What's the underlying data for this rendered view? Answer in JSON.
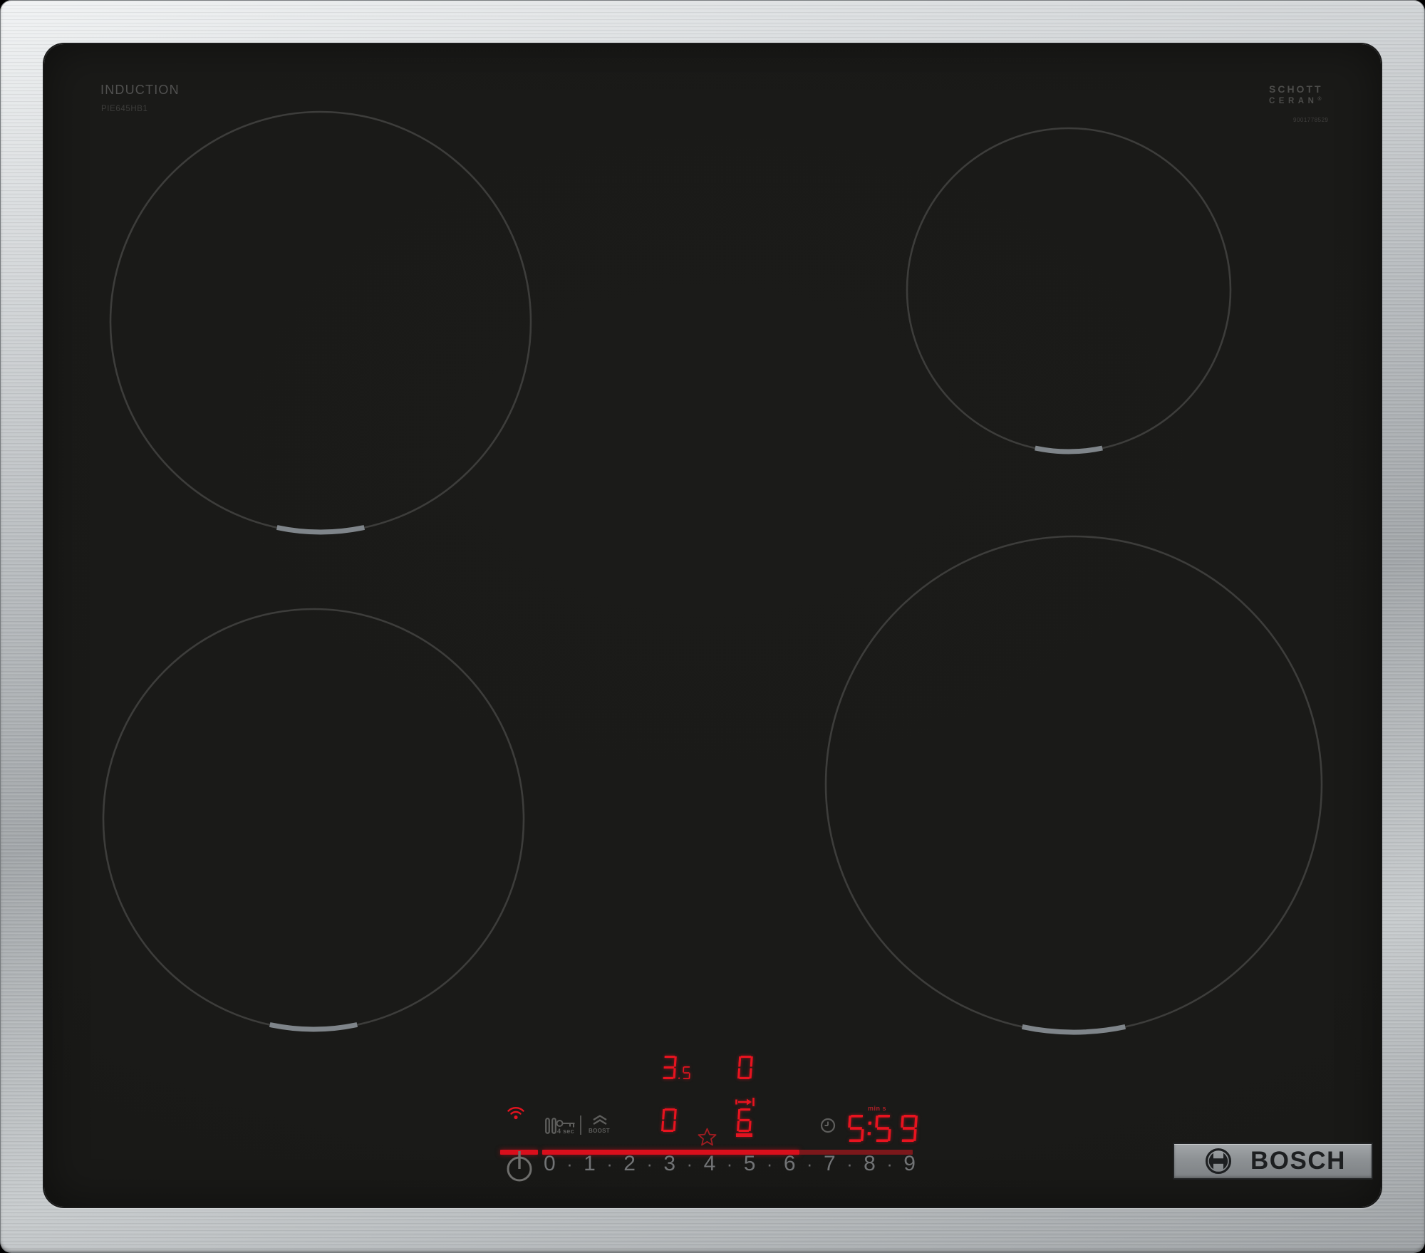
{
  "hob": {
    "type_label": "INDUCTION",
    "model": "PIE645HB1",
    "glass_brand_line1": "SCHOTT",
    "glass_brand_line2": "CERAN",
    "registered_mark": "®",
    "serial": "9001778529",
    "brand": "BOSCH"
  },
  "control_panel": {
    "zone_displays": {
      "back_left": "3.5",
      "back_right": "0",
      "front_left": "0",
      "front_right": "6"
    },
    "timer": {
      "display": "5:5 9",
      "value": "5:59",
      "unit_label": "min s"
    },
    "key_lock_label": "4 sec",
    "boost_label": "BOOST",
    "scale_numbers": [
      "0",
      "1",
      "2",
      "3",
      "4",
      "5",
      "6",
      "7",
      "8",
      "9"
    ],
    "scale_separator": "·"
  },
  "colors": {
    "display_red": "#e8131f",
    "slider_red": "#d90f1c",
    "slider_dim_red": "#7b181b",
    "icon_gray": "#5e5e5c",
    "print_gray": "#4c4c4a"
  }
}
